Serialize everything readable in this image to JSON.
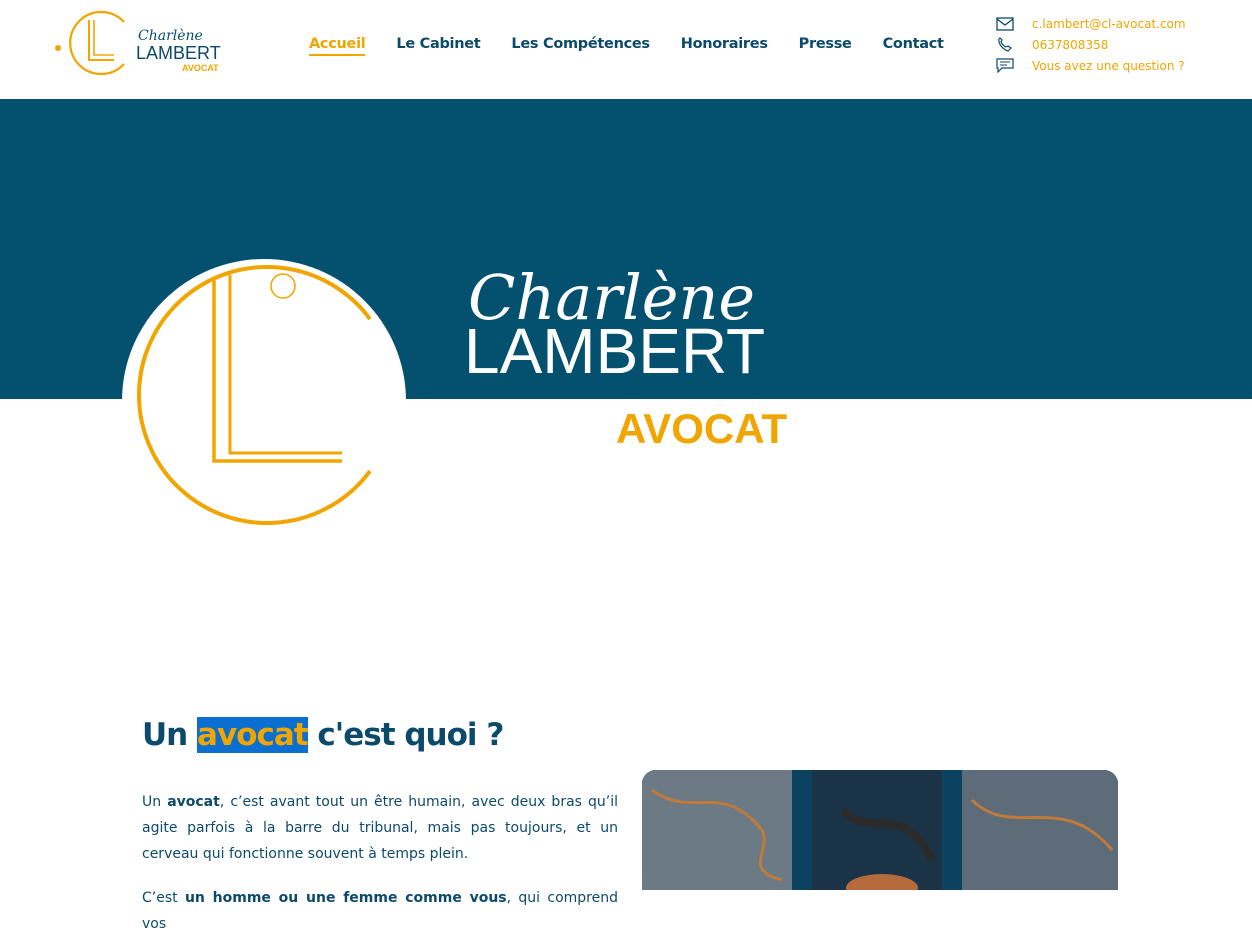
{
  "logo": {
    "script": "Charlène",
    "name": "LAMBERT",
    "sub": "AVOCAT"
  },
  "nav": [
    {
      "label": "Accueil",
      "active": true
    },
    {
      "label": "Le Cabinet"
    },
    {
      "label": "Les Compétences"
    },
    {
      "label": "Honoraires"
    },
    {
      "label": "Presse"
    },
    {
      "label": "Contact"
    }
  ],
  "contact": {
    "email": "c.lambert@cl-avocat.com",
    "phone": "0637808358",
    "question": "Vous avez une question ?"
  },
  "hero": {
    "script": "Charlène",
    "name": "LAMBERT",
    "sub": "AVOCAT"
  },
  "section": {
    "heading_pre": "Un",
    "heading_hl": "avocat",
    "heading_post": "c'est quoi ?",
    "p1_a": "Un ",
    "p1_b": "avocat",
    "p1_c": ", c’est avant tout un être humain, avec deux bras qu’il agite parfois à la barre du tribunal, mais pas toujours, et un cerveau qui fonctionne souvent à temps plein.",
    "p2_a": "C’est ",
    "p2_b": "un homme ou une femme comme vous",
    "p2_c": ", qui comprend vos"
  },
  "colors": {
    "navy": "#03506f",
    "gold": "#f0a500",
    "text": "#0c4a6b",
    "highlight": "#0a6fd1"
  }
}
